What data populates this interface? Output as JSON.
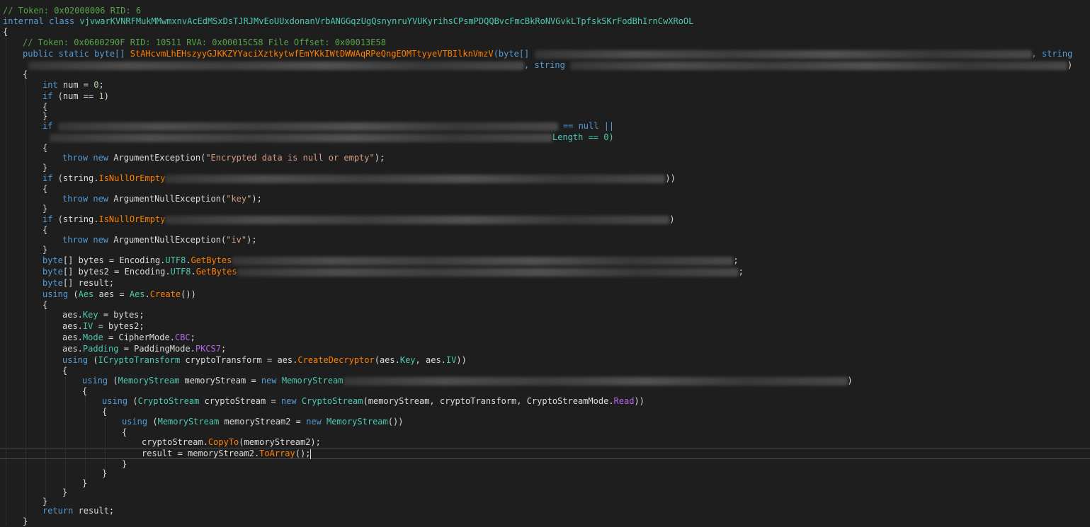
{
  "code": {
    "class_token_comment": "// Token: 0x02000006 RID: 6",
    "class_decl_kw": "internal class",
    "class_name": "vjvwarKVNRFMukMMwmxnvAcEdMSxDsTJRJMvEoUUxdonanVrbANGGqzUgQsnynruYVUKyrihsCPsmPDQQBvcFmcBkRoNVGvkLTpfskSKrFodBhIrnCwXRoOL",
    "open_brace": "{",
    "close_brace": "}",
    "method_token_comment": "// Token: 0x0600290F RID: 10511 RVA: 0x00015C58 File Offset: 0x00013E58",
    "method_modifiers": "public static",
    "method_return_type": "byte[]",
    "method_name": "StAHcvmLhEHszyyGJKKZYYaciXztkytwfEmYKkIWtDWWAqRPeQngEOMTtyyeVTBIlknVmzV",
    "param1_type": "(byte[]",
    "comma_string": ", string",
    "string_kw": "string",
    "close_paren": ")",
    "int_kw": "int",
    "num_decl": " num = ",
    "zero": "0",
    "semicolon": ";",
    "if_kw": "if",
    "num_eq_open": " (num == ",
    "one": "1",
    "null_check_tail": " == null ||",
    "length_tail": "Length == 0)",
    "throw_new": "throw new",
    "arg_exception": "ArgumentException",
    "msg_encrypted": "\"Encrypted data is null or empty\"",
    "open_paren_str": "(",
    "close_semicolon": ");",
    "if_string_open": " (string.",
    "is_null_or_empty": "IsNullOrEmpty",
    "double_close": "))",
    "arg_null_exception": "ArgumentNullException",
    "msg_key": "\"key\"",
    "msg_iv": "\"iv\"",
    "byte_kw": "byte",
    "bytes_decl": "[] bytes = Encoding.",
    "bytes2_decl": "[] bytes2 = Encoding.",
    "utf8": "UTF8",
    "dot": ".",
    "get_bytes": "GetBytes",
    "result_decl": "[] result;",
    "using_kw": "using",
    "aes_type": "Aes",
    "aes_decl_mid": " aes = ",
    "create": "Create",
    "aes_create_tail": "())",
    "aes_key_pre": "aes.",
    "key_prop": "Key",
    "key_tail": " = bytes;",
    "iv_prop": "IV",
    "iv_tail": " = bytes2;",
    "mode_prop": "Mode",
    "mode_mid": " = CipherMode.",
    "cbc": "CBC",
    "padding_prop": "Padding",
    "padding_mid": " = PaddingMode.",
    "pkcs7": "PKCS7",
    "icrypto_type": "ICryptoTransform",
    "crypto_transform_mid": " cryptoTransform = aes.",
    "create_decryptor": "CreateDecryptor",
    "decryptor_args_1": "(aes.",
    "decryptor_args_2": ", aes.",
    "decryptor_close": "))",
    "memory_stream_type": "MemoryStream",
    "ms_decl_mid": " memoryStream = ",
    "new_kw": "new",
    "crypto_stream_type": "CryptoStream",
    "cs_decl_mid": " cryptoStream = ",
    "cs_args": "(memoryStream, cryptoTransform, CryptoStreamMode.",
    "read_enum": "Read",
    "ms2_decl_mid": " memoryStream2 = ",
    "ms2_create_tail": "())",
    "copy_to_pre": "cryptoStream.",
    "copy_to": "CopyTo",
    "copy_to_tail": "(memoryStream2);",
    "result_assign_pre": "result = memoryStream2.",
    "to_array": "ToArray",
    "to_array_tail": "();",
    "return_kw": "return",
    "return_tail": " result;"
  }
}
